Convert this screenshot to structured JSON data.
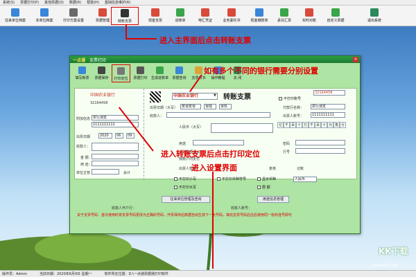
{
  "menubar": [
    "系统(S)",
    "票据打印(P)",
    "其他票据(O)",
    "数据(R)",
    "帮助(H)",
    "基础信息维护(R)"
  ],
  "toolbar": [
    {
      "label": "往来单位档案",
      "color": "#3a86d9"
    },
    {
      "label": "本单位档案",
      "color": "#3a86d9"
    },
    {
      "label": "打印方案设置",
      "color": "#6a6a6a"
    },
    {
      "label": "票据管理",
      "color": "#d94a3a"
    },
    {
      "label": "转账支票",
      "color": "#333333"
    },
    {
      "label": "现金支票",
      "color": "#d94a3a"
    },
    {
      "label": "进账单",
      "color": "#3aa64a"
    },
    {
      "label": "电汇凭证",
      "color": "#d94a3a"
    },
    {
      "label": "业务委托书",
      "color": "#d94a3a"
    },
    {
      "label": "现金缴款单",
      "color": "#3a86d9"
    },
    {
      "label": "承兑汇票",
      "color": "#3aa64a"
    },
    {
      "label": "实时对账",
      "color": "#d94a3a"
    },
    {
      "label": "自定义票据",
      "color": "#3aa64a"
    },
    {
      "label": "退出系统",
      "color": "#2a8a5a"
    }
  ],
  "annotations": {
    "top": "进入主界面后点击转账支票",
    "bank": "如有多个不同的银行需要分别设置",
    "position": "进入转账支票后点击打印定位",
    "settings": "进入设置界面"
  },
  "dialog": {
    "title": "支票打印",
    "brand": "一点通",
    "tools": [
      "填写新票",
      "票据保存",
      "打印定位",
      "票据打印",
      "生成进账单",
      "票据查询",
      "支票背书",
      "操作教程",
      "关 闭"
    ],
    "bank_name": "中国农业银行",
    "bank_select": "中国农业银行",
    "check_title": "转账支票",
    "check_no_label": "不打印账号",
    "check_no": "32164458",
    "stub_bank": "中国农业银行",
    "stub_no": "32164458",
    "stub_labels": [
      "附加信息",
      "出票日期",
      "收款人：",
      "金 额：",
      "用 途：",
      "单位主管",
      "会计"
    ],
    "stub_payee": "农行测支",
    "stub_account": "1111111111",
    "stub_date": [
      "2020",
      "06",
      "09"
    ],
    "date_label": "出票日期（大写）",
    "date_values": [
      "贰零贰零",
      "零陆",
      "零玖"
    ],
    "payee_label": "收款人：",
    "payer_bank_label": "付款行名称：",
    "payer_bank": "农行测支",
    "payer_acct_label": "出票人账号：",
    "payer_acct": "1111111111",
    "amount_label": "人民币（大写）",
    "amount_units": [
      "亿",
      "千",
      "百",
      "十",
      "万",
      "千",
      "百",
      "十",
      "元",
      "角",
      "分"
    ],
    "purpose_label": "用途",
    "password_label": "密码",
    "line_label": "行号",
    "above_label": "上列款项请从",
    "account_label": "我账户内支付",
    "drawer_label": "出票人签章",
    "review_label": "复核",
    "record_label": "记账",
    "options": [
      "不打印小写",
      "不打印币种符号",
      "显示币种",
      "不打印大写",
      "限  额"
    ],
    "currency": "人民币",
    "btn_payee": "往来单位管理及查询",
    "btn_purpose": "用途信息管理",
    "payee_info": "收款人开户行：",
    "acct_info": "收款人账号：",
    "notice": "关于支票号码：首次使用时将支票号码更改为正确的号码，开票保存后数据自动生成下一张号码，填完支票号码后往后使用同一张的连号即可"
  },
  "status": {
    "operator": "操作员：Admin",
    "date": "当前日期：2020年6月9日 星期一",
    "path": "软件所在位置：D:\\一点通票据通打印软件"
  },
  "watermark": {
    "brand": "KK下载",
    "url": "www.kkx.net"
  }
}
